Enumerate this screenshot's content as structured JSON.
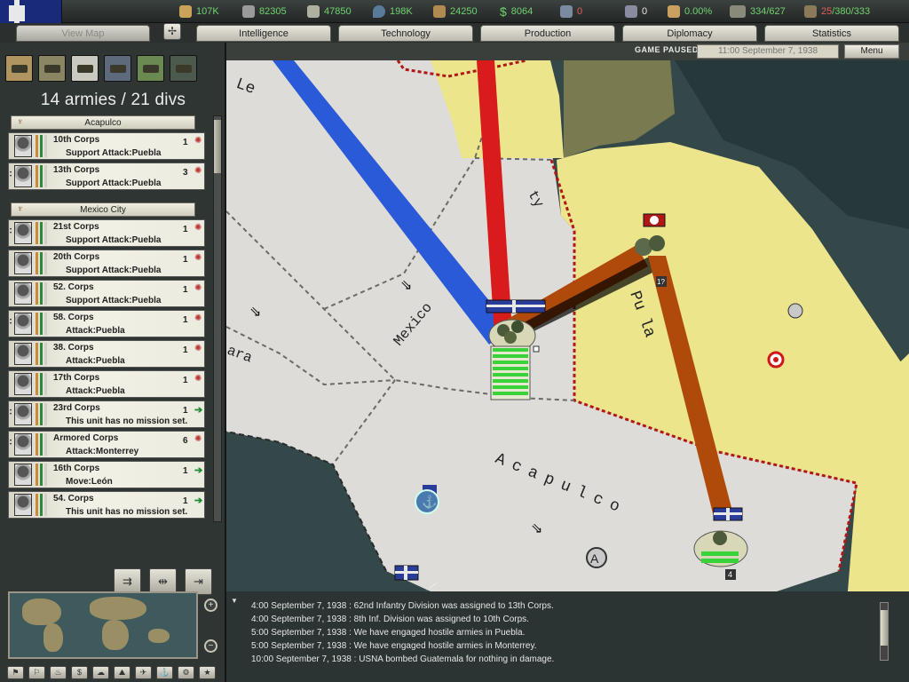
{
  "resources": [
    {
      "name": "energy",
      "value": "107K",
      "color": "#6fd26f",
      "icon": "energy-icon"
    },
    {
      "name": "metal",
      "value": "82305",
      "color": "#6fd26f",
      "icon": "metal-icon"
    },
    {
      "name": "rare-materials",
      "value": "47850",
      "color": "#6fd26f",
      "icon": "rare-materials-icon"
    },
    {
      "name": "oil",
      "value": "198K",
      "color": "#6fd26f",
      "icon": "oil-icon"
    },
    {
      "name": "supplies",
      "value": "24250",
      "color": "#6fd26f",
      "icon": "supplies-icon"
    },
    {
      "name": "money",
      "value": "8064",
      "color": "#6fd26f",
      "icon": "money-icon"
    },
    {
      "name": "manpower",
      "value": "0",
      "color": "#e85a5a",
      "icon": "manpower-icon"
    },
    {
      "name": "diplomacy",
      "value": "0",
      "color": "#e6e6e6",
      "icon": "diplomacy-icon"
    },
    {
      "name": "dissent",
      "value": "0.00%",
      "color": "#6fd26f",
      "icon": "dissent-icon"
    },
    {
      "name": "transport",
      "value": "334/627",
      "color": "#6fd26f",
      "icon": "transport-icon"
    },
    {
      "name": "ic",
      "value_red": "25",
      "value_rest": "/380/333",
      "color": "#e85a5a",
      "icon": "industry-icon"
    }
  ],
  "tabs": {
    "view_map": "View Map",
    "intelligence": "Intelligence",
    "technology": "Technology",
    "production": "Production",
    "diplomacy": "Diplomacy",
    "statistics": "Statistics"
  },
  "status": {
    "paused": "GAME PAUSED",
    "datetime": "11:00 September 7, 1938",
    "menu": "Menu"
  },
  "left_panel": {
    "title": "14 armies / 21 divs",
    "groups": [
      {
        "name": "Acapulco",
        "units": [
          {
            "name": "10th Corps",
            "mission": "Support Attack:Puebla",
            "count": "1",
            "status": "star"
          },
          {
            "name": "13th Corps",
            "mission": "Support Attack:Puebla",
            "count": "3",
            "status": "star"
          }
        ]
      },
      {
        "name": "Mexico City",
        "units": [
          {
            "name": "21st Corps",
            "mission": "Support Attack:Puebla",
            "count": "1",
            "status": "star"
          },
          {
            "name": "20th Corps",
            "mission": "Support Attack:Puebla",
            "count": "1",
            "status": "star"
          },
          {
            "name": "52. Corps",
            "mission": "Support Attack:Puebla",
            "count": "1",
            "status": "star"
          },
          {
            "name": "58. Corps",
            "mission": "Attack:Puebla",
            "count": "1",
            "status": "star"
          },
          {
            "name": "38. Corps",
            "mission": "Attack:Puebla",
            "count": "1",
            "status": "star"
          },
          {
            "name": "17th Corps",
            "mission": "Attack:Puebla",
            "count": "1",
            "status": "star"
          },
          {
            "name": "23rd Corps",
            "mission": "This unit has no mission set.",
            "count": "1",
            "status": "arrow"
          },
          {
            "name": "Armored Corps",
            "mission": "Attack:Monterrey",
            "count": "6",
            "status": "star"
          },
          {
            "name": "16th Corps",
            "mission": "Move:León",
            "count": "1",
            "status": "arrow"
          },
          {
            "name": "54. Corps",
            "mission": "This unit has no mission set.",
            "count": "1",
            "status": "arrow"
          }
        ]
      }
    ]
  },
  "map": {
    "labels": {
      "mexico": "Mexico",
      "acapulco": "Acapulco",
      "puebla": "Pu la",
      "ara": "ara",
      "le": "Le",
      "city": "ty"
    },
    "badges": {
      "stack_a": "1?",
      "stack_b": "4"
    }
  },
  "log": [
    "4:00 September 7, 1938 : 62nd Infantry Division was assigned to 13th Corps.",
    "4:00 September 7, 1938 : 8th Inf. Division was assigned to 10th Corps.",
    "5:00 September 7, 1938 : We have engaged hostile armies in Puebla.",
    "5:00 September 7, 1938 : We have engaged hostile armies in Monterrey.",
    "10:00 September 7, 1938 : USNA bombed Guatemala for nothing in damage."
  ]
}
